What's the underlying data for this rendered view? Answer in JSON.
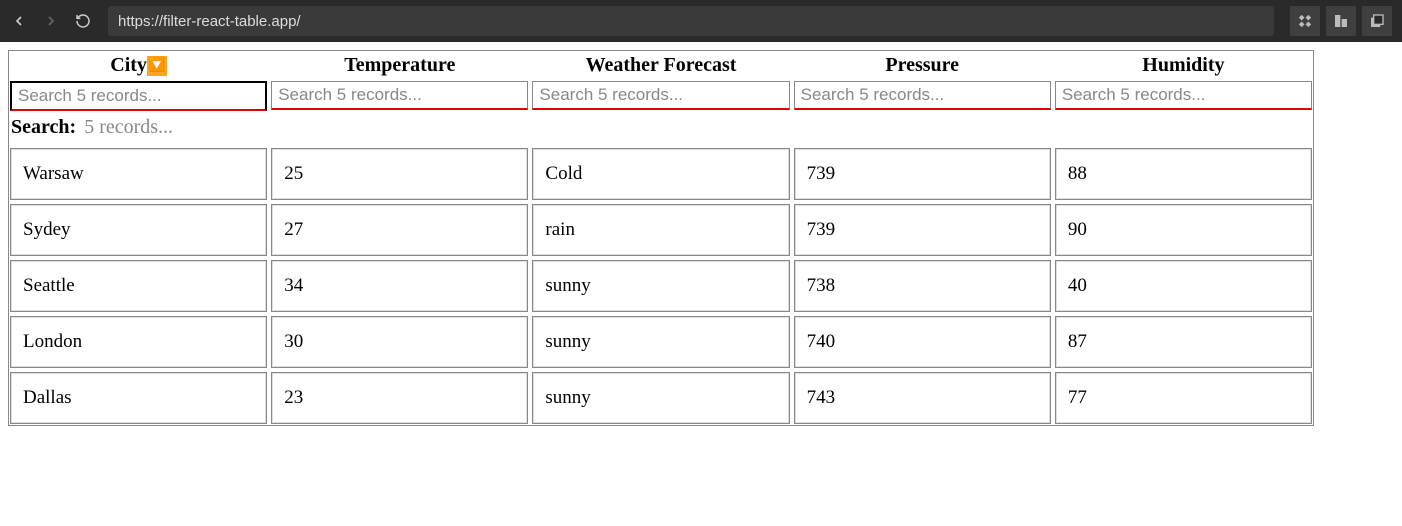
{
  "browser": {
    "url": "https://filter-react-table.app/"
  },
  "table": {
    "columns": [
      {
        "label": "City",
        "sorted": true,
        "filter_placeholder": "Search 5 records..."
      },
      {
        "label": "Temperature",
        "sorted": false,
        "filter_placeholder": "Search 5 records..."
      },
      {
        "label": "Weather Forecast",
        "sorted": false,
        "filter_placeholder": "Search 5 records..."
      },
      {
        "label": "Pressure",
        "sorted": false,
        "filter_placeholder": "Search 5 records..."
      },
      {
        "label": "Humidity",
        "sorted": false,
        "filter_placeholder": "Search 5 records..."
      }
    ],
    "global_search": {
      "label": "Search:",
      "placeholder": "5 records..."
    },
    "rows": [
      {
        "city": "Warsaw",
        "temperature": "25",
        "forecast": "Cold",
        "pressure": "739",
        "humidity": "88"
      },
      {
        "city": "Sydey",
        "temperature": "27",
        "forecast": "rain",
        "pressure": "739",
        "humidity": "90"
      },
      {
        "city": "Seattle",
        "temperature": "34",
        "forecast": "sunny",
        "pressure": "738",
        "humidity": "40"
      },
      {
        "city": "London",
        "temperature": "30",
        "forecast": "sunny",
        "pressure": "740",
        "humidity": "87"
      },
      {
        "city": "Dallas",
        "temperature": "23",
        "forecast": "sunny",
        "pressure": "743",
        "humidity": "77"
      }
    ]
  }
}
